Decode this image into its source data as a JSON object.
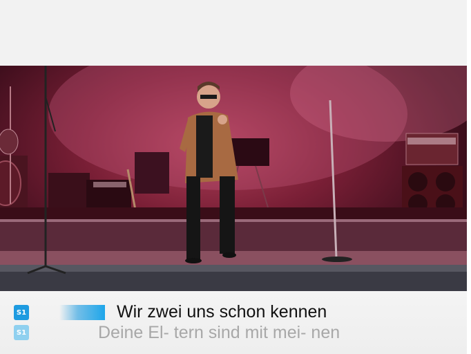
{
  "lyrics": {
    "singer1_badge": "S1",
    "singer2_badge": "S1",
    "current_line": "Wir zwei uns schon kennen",
    "next_line": "Deine El- tern sind mit mei- nen",
    "sing_progress": 0.45
  },
  "colors": {
    "badge_active": "#1e9be0",
    "badge_inactive": "#8fd0ef",
    "current_line": "#111111",
    "next_line": "#a8a8a8"
  }
}
